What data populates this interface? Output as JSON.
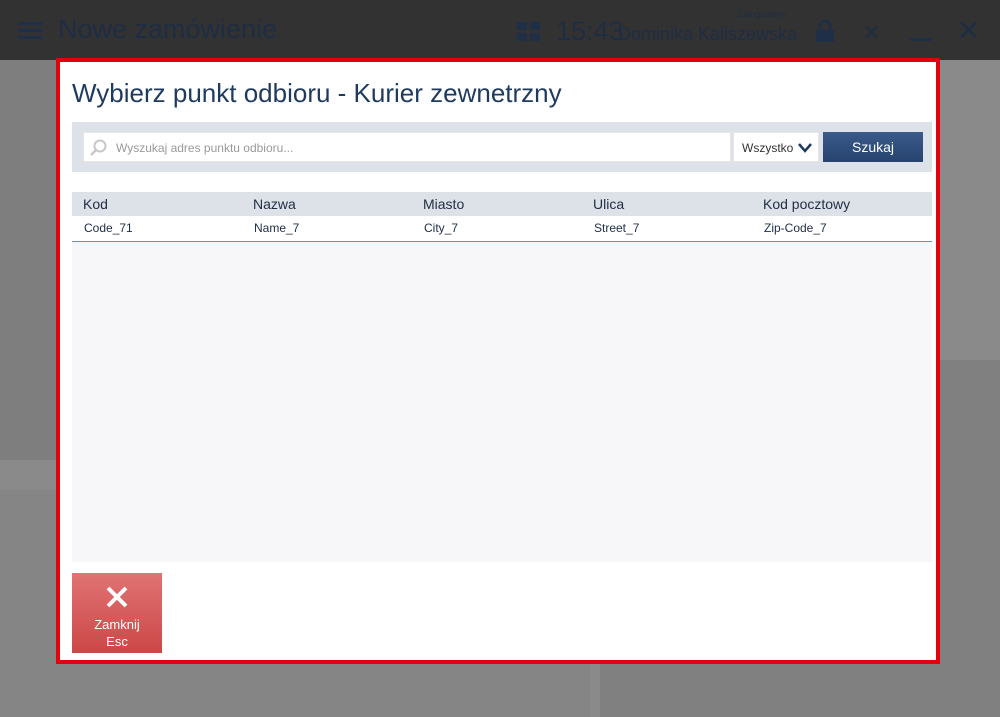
{
  "background": {
    "title": "Nowe zamówienie",
    "time": "15:43",
    "logged_label": "Zalogowany",
    "user": "Dominika Kaliszewska"
  },
  "modal": {
    "title": "Wybierz punkt odbioru - Kurier zewnetrzny",
    "search": {
      "placeholder": "Wyszukaj adres punktu odbioru...",
      "value": ""
    },
    "filter": {
      "selected": "Wszystko"
    },
    "search_button": "Szukaj",
    "table": {
      "columns": [
        "Kod",
        "Nazwa",
        "Miasto",
        "Ulica",
        "Kod pocztowy"
      ],
      "rows": [
        [
          "Code_71",
          "Name_7",
          "City_7",
          "Street_7",
          "Zip-Code_7"
        ]
      ]
    },
    "close_button": {
      "label": "Zamknij",
      "shortcut": "Esc"
    }
  },
  "colors": {
    "accent_border": "#e3000f",
    "primary_button": "#26436e",
    "close_button": "#cc4747"
  }
}
